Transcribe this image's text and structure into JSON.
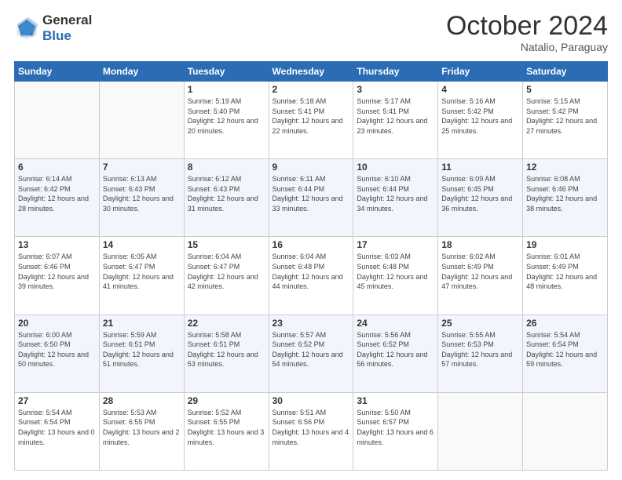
{
  "logo": {
    "general": "General",
    "blue": "Blue"
  },
  "header": {
    "month": "October 2024",
    "location": "Natalio, Paraguay"
  },
  "days_of_week": [
    "Sunday",
    "Monday",
    "Tuesday",
    "Wednesday",
    "Thursday",
    "Friday",
    "Saturday"
  ],
  "weeks": [
    [
      {
        "day": "",
        "sunrise": "",
        "sunset": "",
        "daylight": ""
      },
      {
        "day": "",
        "sunrise": "",
        "sunset": "",
        "daylight": ""
      },
      {
        "day": "1",
        "sunrise": "Sunrise: 5:19 AM",
        "sunset": "Sunset: 5:40 PM",
        "daylight": "Daylight: 12 hours and 20 minutes."
      },
      {
        "day": "2",
        "sunrise": "Sunrise: 5:18 AM",
        "sunset": "Sunset: 5:41 PM",
        "daylight": "Daylight: 12 hours and 22 minutes."
      },
      {
        "day": "3",
        "sunrise": "Sunrise: 5:17 AM",
        "sunset": "Sunset: 5:41 PM",
        "daylight": "Daylight: 12 hours and 23 minutes."
      },
      {
        "day": "4",
        "sunrise": "Sunrise: 5:16 AM",
        "sunset": "Sunset: 5:42 PM",
        "daylight": "Daylight: 12 hours and 25 minutes."
      },
      {
        "day": "5",
        "sunrise": "Sunrise: 5:15 AM",
        "sunset": "Sunset: 5:42 PM",
        "daylight": "Daylight: 12 hours and 27 minutes."
      }
    ],
    [
      {
        "day": "6",
        "sunrise": "Sunrise: 6:14 AM",
        "sunset": "Sunset: 6:42 PM",
        "daylight": "Daylight: 12 hours and 28 minutes."
      },
      {
        "day": "7",
        "sunrise": "Sunrise: 6:13 AM",
        "sunset": "Sunset: 6:43 PM",
        "daylight": "Daylight: 12 hours and 30 minutes."
      },
      {
        "day": "8",
        "sunrise": "Sunrise: 6:12 AM",
        "sunset": "Sunset: 6:43 PM",
        "daylight": "Daylight: 12 hours and 31 minutes."
      },
      {
        "day": "9",
        "sunrise": "Sunrise: 6:11 AM",
        "sunset": "Sunset: 6:44 PM",
        "daylight": "Daylight: 12 hours and 33 minutes."
      },
      {
        "day": "10",
        "sunrise": "Sunrise: 6:10 AM",
        "sunset": "Sunset: 6:44 PM",
        "daylight": "Daylight: 12 hours and 34 minutes."
      },
      {
        "day": "11",
        "sunrise": "Sunrise: 6:09 AM",
        "sunset": "Sunset: 6:45 PM",
        "daylight": "Daylight: 12 hours and 36 minutes."
      },
      {
        "day": "12",
        "sunrise": "Sunrise: 6:08 AM",
        "sunset": "Sunset: 6:46 PM",
        "daylight": "Daylight: 12 hours and 38 minutes."
      }
    ],
    [
      {
        "day": "13",
        "sunrise": "Sunrise: 6:07 AM",
        "sunset": "Sunset: 6:46 PM",
        "daylight": "Daylight: 12 hours and 39 minutes."
      },
      {
        "day": "14",
        "sunrise": "Sunrise: 6:05 AM",
        "sunset": "Sunset: 6:47 PM",
        "daylight": "Daylight: 12 hours and 41 minutes."
      },
      {
        "day": "15",
        "sunrise": "Sunrise: 6:04 AM",
        "sunset": "Sunset: 6:47 PM",
        "daylight": "Daylight: 12 hours and 42 minutes."
      },
      {
        "day": "16",
        "sunrise": "Sunrise: 6:04 AM",
        "sunset": "Sunset: 6:48 PM",
        "daylight": "Daylight: 12 hours and 44 minutes."
      },
      {
        "day": "17",
        "sunrise": "Sunrise: 6:03 AM",
        "sunset": "Sunset: 6:48 PM",
        "daylight": "Daylight: 12 hours and 45 minutes."
      },
      {
        "day": "18",
        "sunrise": "Sunrise: 6:02 AM",
        "sunset": "Sunset: 6:49 PM",
        "daylight": "Daylight: 12 hours and 47 minutes."
      },
      {
        "day": "19",
        "sunrise": "Sunrise: 6:01 AM",
        "sunset": "Sunset: 6:49 PM",
        "daylight": "Daylight: 12 hours and 48 minutes."
      }
    ],
    [
      {
        "day": "20",
        "sunrise": "Sunrise: 6:00 AM",
        "sunset": "Sunset: 6:50 PM",
        "daylight": "Daylight: 12 hours and 50 minutes."
      },
      {
        "day": "21",
        "sunrise": "Sunrise: 5:59 AM",
        "sunset": "Sunset: 6:51 PM",
        "daylight": "Daylight: 12 hours and 51 minutes."
      },
      {
        "day": "22",
        "sunrise": "Sunrise: 5:58 AM",
        "sunset": "Sunset: 6:51 PM",
        "daylight": "Daylight: 12 hours and 53 minutes."
      },
      {
        "day": "23",
        "sunrise": "Sunrise: 5:57 AM",
        "sunset": "Sunset: 6:52 PM",
        "daylight": "Daylight: 12 hours and 54 minutes."
      },
      {
        "day": "24",
        "sunrise": "Sunrise: 5:56 AM",
        "sunset": "Sunset: 6:52 PM",
        "daylight": "Daylight: 12 hours and 56 minutes."
      },
      {
        "day": "25",
        "sunrise": "Sunrise: 5:55 AM",
        "sunset": "Sunset: 6:53 PM",
        "daylight": "Daylight: 12 hours and 57 minutes."
      },
      {
        "day": "26",
        "sunrise": "Sunrise: 5:54 AM",
        "sunset": "Sunset: 6:54 PM",
        "daylight": "Daylight: 12 hours and 59 minutes."
      }
    ],
    [
      {
        "day": "27",
        "sunrise": "Sunrise: 5:54 AM",
        "sunset": "Sunset: 6:54 PM",
        "daylight": "Daylight: 13 hours and 0 minutes."
      },
      {
        "day": "28",
        "sunrise": "Sunrise: 5:53 AM",
        "sunset": "Sunset: 6:55 PM",
        "daylight": "Daylight: 13 hours and 2 minutes."
      },
      {
        "day": "29",
        "sunrise": "Sunrise: 5:52 AM",
        "sunset": "Sunset: 6:55 PM",
        "daylight": "Daylight: 13 hours and 3 minutes."
      },
      {
        "day": "30",
        "sunrise": "Sunrise: 5:51 AM",
        "sunset": "Sunset: 6:56 PM",
        "daylight": "Daylight: 13 hours and 4 minutes."
      },
      {
        "day": "31",
        "sunrise": "Sunrise: 5:50 AM",
        "sunset": "Sunset: 6:57 PM",
        "daylight": "Daylight: 13 hours and 6 minutes."
      },
      {
        "day": "",
        "sunrise": "",
        "sunset": "",
        "daylight": ""
      },
      {
        "day": "",
        "sunrise": "",
        "sunset": "",
        "daylight": ""
      }
    ]
  ]
}
